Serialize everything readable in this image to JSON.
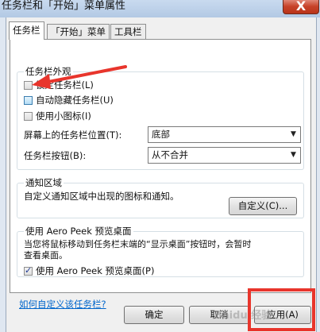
{
  "window": {
    "title": "任务栏和「开始」菜单属性",
    "close": "X"
  },
  "tabs": [
    {
      "label": "任务栏"
    },
    {
      "label": "「开始」菜单"
    },
    {
      "label": "工具栏"
    }
  ],
  "appearance": {
    "title": "任务栏外观",
    "lock": "锁定任务栏(L)",
    "autohide": "自动隐藏任务栏(U)",
    "small_icons": "使用小图标(I)",
    "location_label": "屏幕上的任务栏位置(T):",
    "location_value": "底部",
    "buttons_label": "任务栏按钮(B):",
    "buttons_value": "从不合并"
  },
  "notify": {
    "title": "通知区域",
    "desc": "自定义通知区域中出现的图标和通知。",
    "customize_btn": "自定义(C)..."
  },
  "peek": {
    "title": "使用 Aero Peek 预览桌面",
    "desc_line1": "当您将鼠标移动到任务栏末端的“显示桌面”按钮时，会暂时",
    "desc_line2": "查看桌面。",
    "checkbox": "使用 Aero Peek 预览桌面(P)"
  },
  "help_link": "如何自定义该任务栏?",
  "footer": {
    "ok": "确定",
    "cancel": "取消",
    "apply": "应用(A)"
  },
  "watermark": "Baidu 经验",
  "colors": {
    "annotation": "#e8352c",
    "link": "#0066cc"
  }
}
